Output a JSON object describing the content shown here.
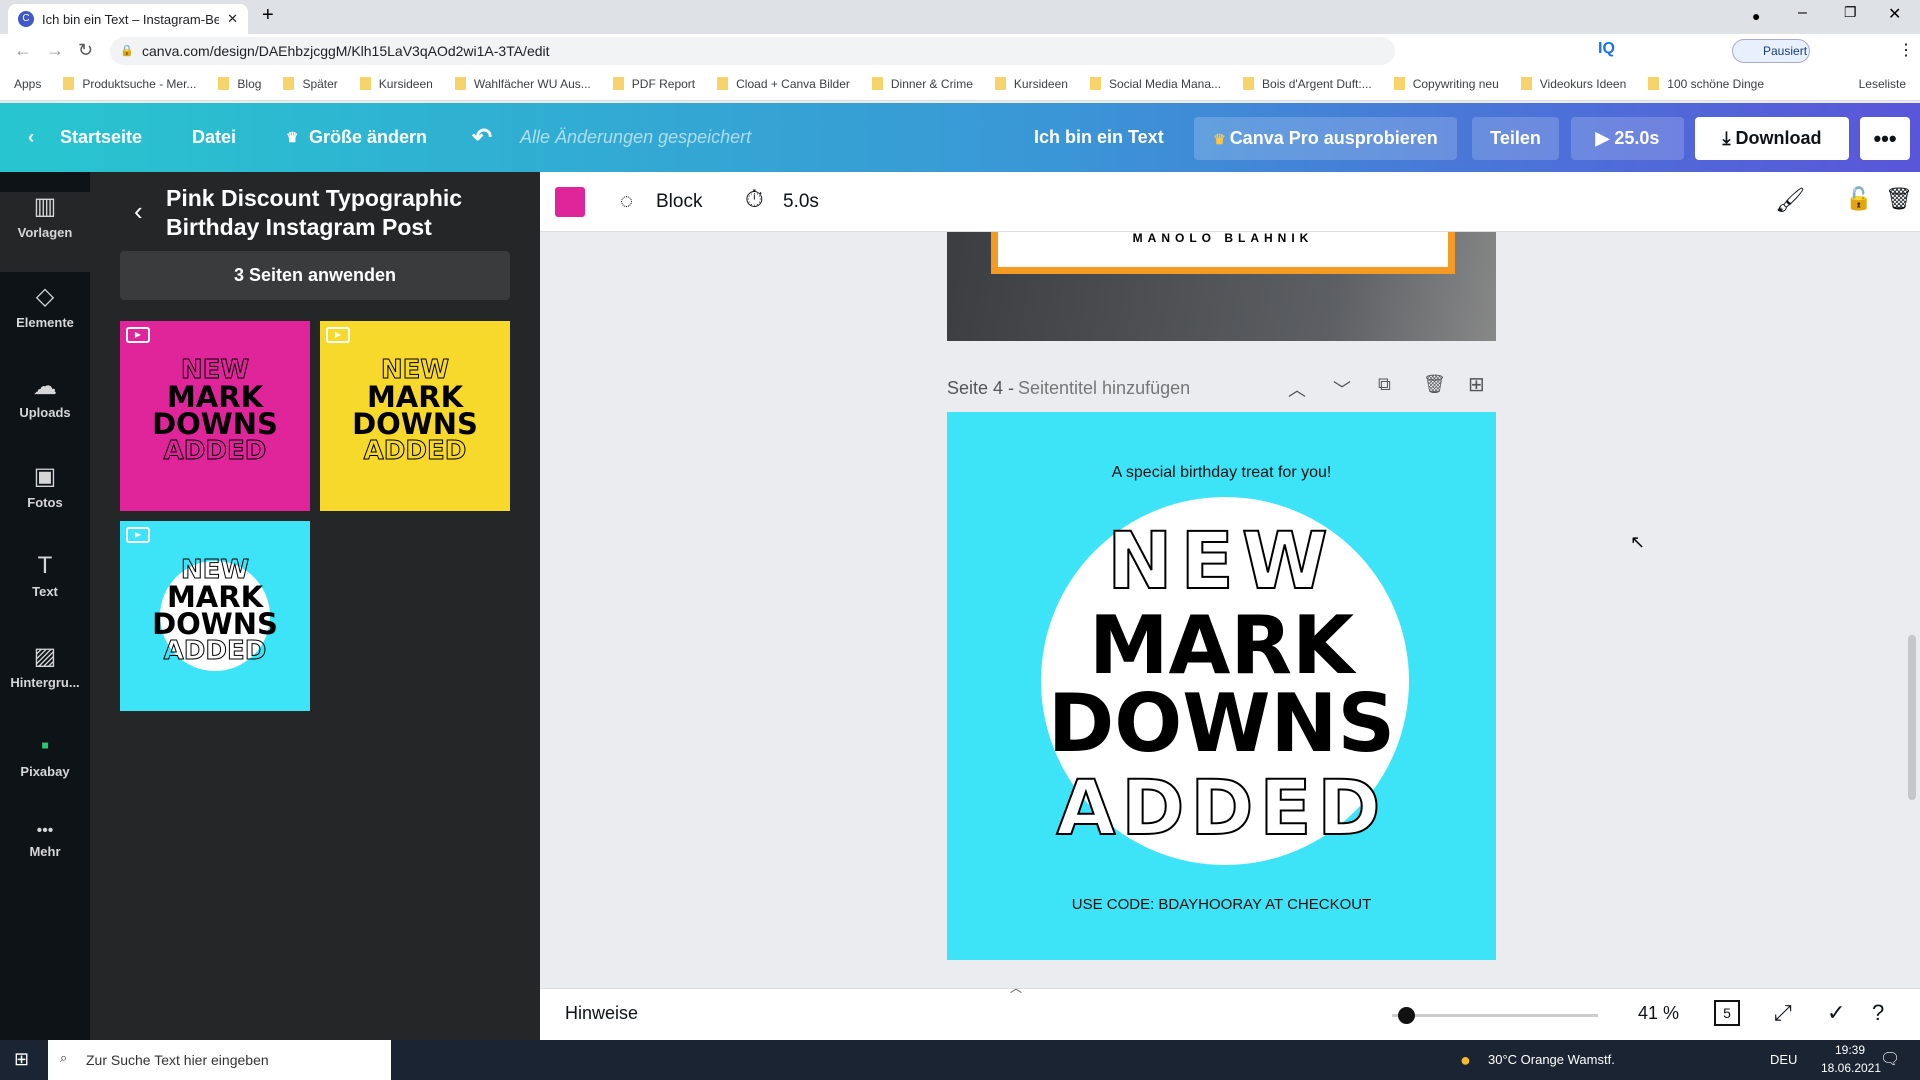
{
  "browser": {
    "tab_title": "Ich bin ein Text – Instagram-Beitr",
    "url": "canva.com/design/DAEhbzjcggM/Klh15LaV3qAOd2wi1A-3TA/edit",
    "profile": "Pausiert",
    "bookmarks": [
      "Apps",
      "Produktsuche - Mer...",
      "Blog",
      "Später",
      "Kursideen",
      "Wahlfächer WU Aus...",
      "PDF Report",
      "Cload + Canva Bilder",
      "Dinner & Crime",
      "Kursideen",
      "Social Media Mana...",
      "Bois d'Argent Duft:...",
      "Copywriting neu",
      "Videokurs Ideen",
      "100 schöne Dinge"
    ],
    "reading_list": "Leseliste"
  },
  "header": {
    "home": "Startseite",
    "file": "Datei",
    "resize": "Größe ändern",
    "saved": "Alle Änderungen gespeichert",
    "design_title": "Ich bin ein Text",
    "pro": "Canva Pro ausprobieren",
    "share": "Teilen",
    "play": "25.0s",
    "download": "Download"
  },
  "rail": [
    {
      "label": "Vorlagen",
      "icon": "▥"
    },
    {
      "label": "Elemente",
      "icon": "◇"
    },
    {
      "label": "Uploads",
      "icon": "☁"
    },
    {
      "label": "Fotos",
      "icon": "▣"
    },
    {
      "label": "Text",
      "icon": "T"
    },
    {
      "label": "Hintergru...",
      "icon": "▨"
    },
    {
      "label": "Pixabay",
      "icon": "▪"
    },
    {
      "label": "Mehr",
      "icon": "•••"
    }
  ],
  "panel": {
    "title": "Pink Discount Typographic Birthday Instagram Post",
    "apply": "3 Seiten anwenden",
    "thumbs": [
      {
        "bg": "#e0259a",
        "l1": "NEW",
        "l2": "MARK",
        "l3": "DOWNS",
        "l4": "ADDED"
      },
      {
        "bg": "#f7d92c",
        "l1": "NEW",
        "l2": "MARK",
        "l3": "DOWNS",
        "l4": "ADDED"
      },
      {
        "bg": "#3de3f7",
        "l1": "NEW",
        "l2": "MARK",
        "l3": "DOWNS",
        "l4": "ADDED"
      }
    ]
  },
  "toolbar": {
    "color": "#e0259a",
    "animation": "Block",
    "duration": "5.0s"
  },
  "canvas": {
    "prev_page_text": "MANOLO BLAHNIK",
    "page_label": "Seite 4 -",
    "page_title_placeholder": "Seitentitel hinzufügen",
    "design": {
      "bg": "#3de3f7",
      "subtitle": "A special birthday treat for you!",
      "l1": "NEW",
      "l2": "MARK",
      "l3": "DOWNS",
      "l4": "ADDED",
      "code": "USE CODE: BDAYHOORAY AT CHECKOUT"
    }
  },
  "bottom": {
    "notes": "Hinweise",
    "zoom": "41 %",
    "zoom_value": 41,
    "pages": "5"
  },
  "taskbar": {
    "search": "Zur Suche Text hier eingeben",
    "weather": "30°C  Orange Wamstf.",
    "lang": "DEU",
    "time": "19:39",
    "date": "18.06.2021"
  }
}
